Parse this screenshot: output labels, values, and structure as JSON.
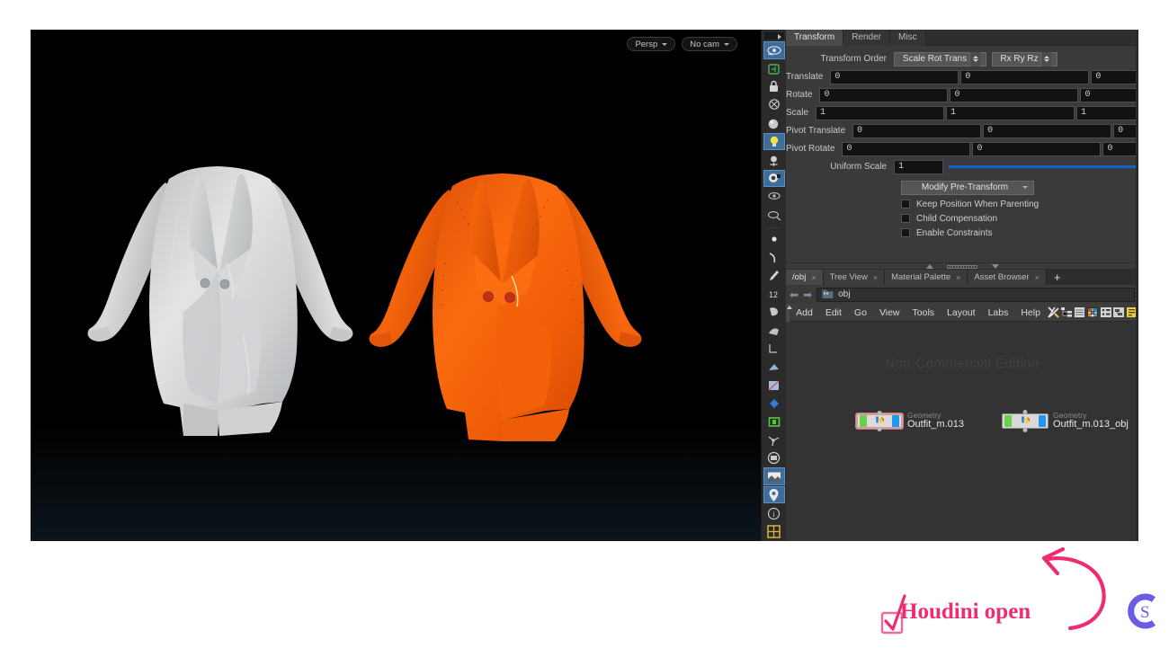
{
  "app": {
    "name": "Houdini",
    "edition_watermark": "Non-Commercial Edition"
  },
  "viewport": {
    "camera_mode": "Persp",
    "camera_select": "No cam",
    "background_color": "#000000",
    "grid_color": "#78a0b9",
    "garments": [
      {
        "name": "blazer-dress-grey",
        "color": "#d2d4d6",
        "lining_color": "#c8cacb",
        "button_color": "#9a9c9e"
      },
      {
        "name": "blazer-dress-orange",
        "color": "#f4600a",
        "lining_color": "#1fe8ea",
        "button_color": "#c0311a"
      }
    ]
  },
  "viewport_toolbar": {
    "icons": [
      "eye-icon",
      "snapshot-icon",
      "lock-icon",
      "ghost-icon",
      "sphere-icon",
      "light-bulb-icon",
      "handle-move-icon",
      "camera-icon",
      "view-pan-icon",
      "view-zoom-icon",
      "point-icon",
      "curve-icon",
      "brush-icon",
      "frame-12-icon",
      "paint-icon",
      "sculpt-icon",
      "smooth-icon",
      "measure-icon",
      "terrain-icon",
      "texture-icon",
      "diamond-icon",
      "green-box-icon",
      "skeleton-icon",
      "disc-icon",
      "image-plane-icon",
      "marker-pin-icon",
      "info-icon",
      "grid-toggle-icon"
    ]
  },
  "parameters": {
    "tabs": [
      {
        "label": "Transform",
        "active": true
      },
      {
        "label": "Render",
        "active": false
      },
      {
        "label": "Misc",
        "active": false
      }
    ],
    "transform_order": {
      "label": "Transform Order",
      "srt_value": "Scale Rot Trans",
      "rot_value": "Rx Ry Rz"
    },
    "rows": [
      {
        "label": "Translate",
        "values": [
          "0",
          "0",
          "0"
        ]
      },
      {
        "label": "Rotate",
        "values": [
          "0",
          "0",
          "0"
        ]
      },
      {
        "label": "Scale",
        "values": [
          "1",
          "1",
          "1"
        ]
      },
      {
        "label": "Pivot Translate",
        "values": [
          "0",
          "0",
          "0"
        ]
      },
      {
        "label": "Pivot Rotate",
        "values": [
          "0",
          "0",
          "0"
        ]
      }
    ],
    "uniform_scale": {
      "label": "Uniform Scale",
      "value": "1",
      "slider_color": "#1263d2"
    },
    "pre_transform_menu": "Modify Pre-Transform",
    "checkboxes": [
      {
        "label": "Keep Position When Parenting",
        "checked": false
      },
      {
        "label": "Child Compensation",
        "checked": false
      },
      {
        "label": "Enable Constraints",
        "checked": false
      }
    ]
  },
  "network": {
    "tabs": [
      {
        "label": "/obj",
        "active": true,
        "closable": true
      },
      {
        "label": "Tree View",
        "active": false,
        "closable": true
      },
      {
        "label": "Material Palette",
        "active": false,
        "closable": true
      },
      {
        "label": "Asset Browser",
        "active": false,
        "closable": true
      }
    ],
    "add_tab_label": "+",
    "path": "obj",
    "menus": [
      "Add",
      "Edit",
      "Go",
      "View",
      "Tools",
      "Layout",
      "Labs",
      "Help"
    ],
    "toolbar_icons": [
      "tools-wrench-icon",
      "hierarchy-icon",
      "list-icon",
      "color-palette-icon",
      "node-shape-icon",
      "network-box-icon",
      "note-icon"
    ],
    "nodes": [
      {
        "type": "Geometry",
        "name": "Outfit_m.013",
        "selected": true
      },
      {
        "type": "Geometry",
        "name": "Outfit_m.013_obj",
        "selected": false
      }
    ]
  },
  "annotation": {
    "label": "Houdini open",
    "label_color": "#ef2b72",
    "checkbox_checked": true,
    "arrow_color": "#ef2b72",
    "logo": {
      "name": "cs-logo",
      "letters": "CS",
      "color": "#6b5ce7"
    }
  }
}
